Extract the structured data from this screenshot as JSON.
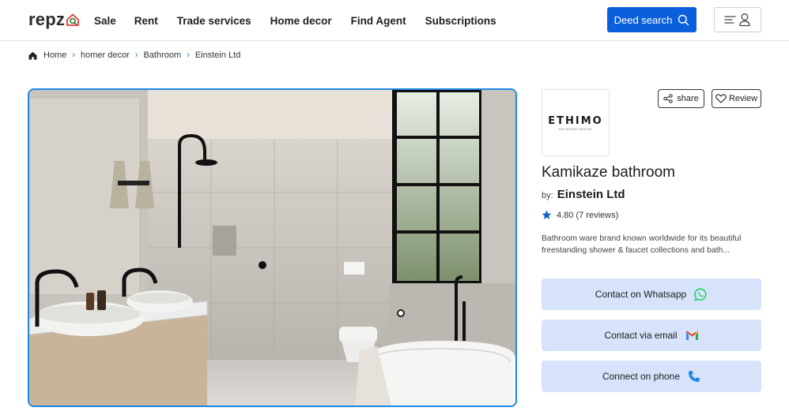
{
  "header": {
    "logo_text": "repz",
    "nav": [
      "Sale",
      "Rent",
      "Trade services",
      "Home decor",
      "Find Agent",
      "Subscriptions"
    ],
    "deed_search_label": "Deed search",
    "icons": {
      "deed_search": "search-icon",
      "menu": "menu-icon",
      "user": "user-icon"
    }
  },
  "breadcrumb": {
    "items": [
      "Home",
      "homer decor",
      "Bathroom",
      "Einstein Ltd"
    ],
    "home_icon": "home-icon",
    "separator_icon": "chevron-right-icon"
  },
  "product": {
    "brand_logo_text": "ETHIMO",
    "brand_logo_subtext": "OUTDOOR DECOR",
    "title": "Kamikaze bathroom",
    "by_label": "by:",
    "seller": "Einstein Ltd",
    "rating_text": "4.80 (7 reviews)",
    "rating_value": 4.8,
    "description": "Bathroom ware brand known worldwide for its beautiful freestanding shower & faucet collections and bath...",
    "share_label": "share",
    "review_label": "Review"
  },
  "contact": {
    "whatsapp_label": "Contact on Whatsapp",
    "email_label": "Contact via email",
    "phone_label": "Connect on phone"
  },
  "colors": {
    "primary": "#0b5fdc",
    "image_border": "#1e88e5",
    "contact_bg": "#d6e3fb",
    "star": "#1565c0",
    "whatsapp": "#25d366",
    "phone": "#1e88e5"
  }
}
